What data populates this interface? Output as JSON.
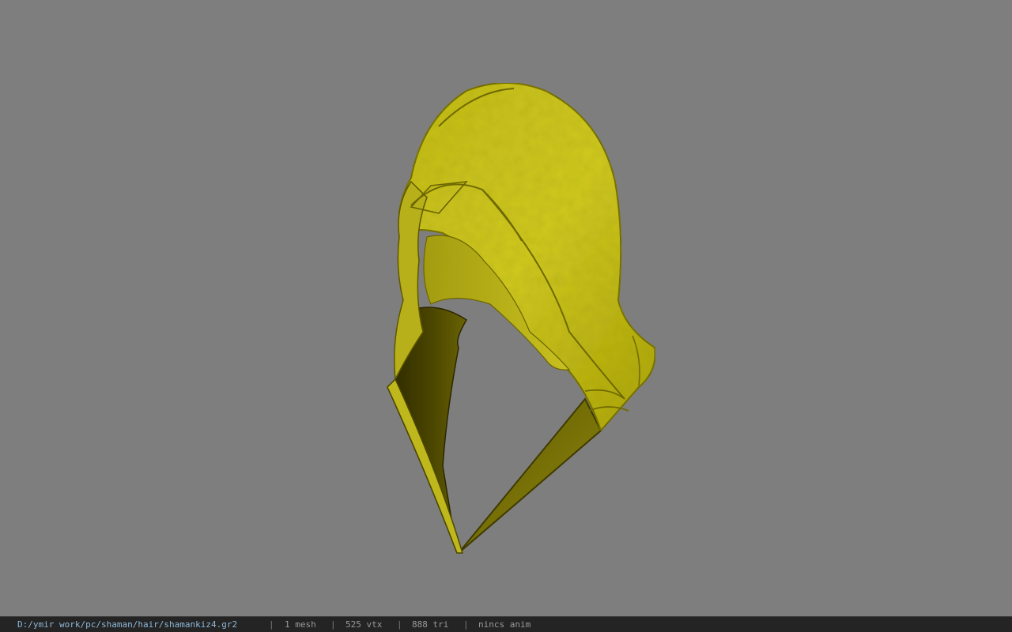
{
  "viewer": {
    "model_name": "hood-model",
    "background_color": "#7e7e7e",
    "model_color": "#c9c21f"
  },
  "status": {
    "file_path": "D:/ymir work/pc/shaman/hair/shamankiz4.gr2",
    "separator": "|",
    "mesh_count": "1 mesh",
    "vertex_count": "525 vtx",
    "triangle_count": "888 tri",
    "anim": "nincs anim"
  }
}
